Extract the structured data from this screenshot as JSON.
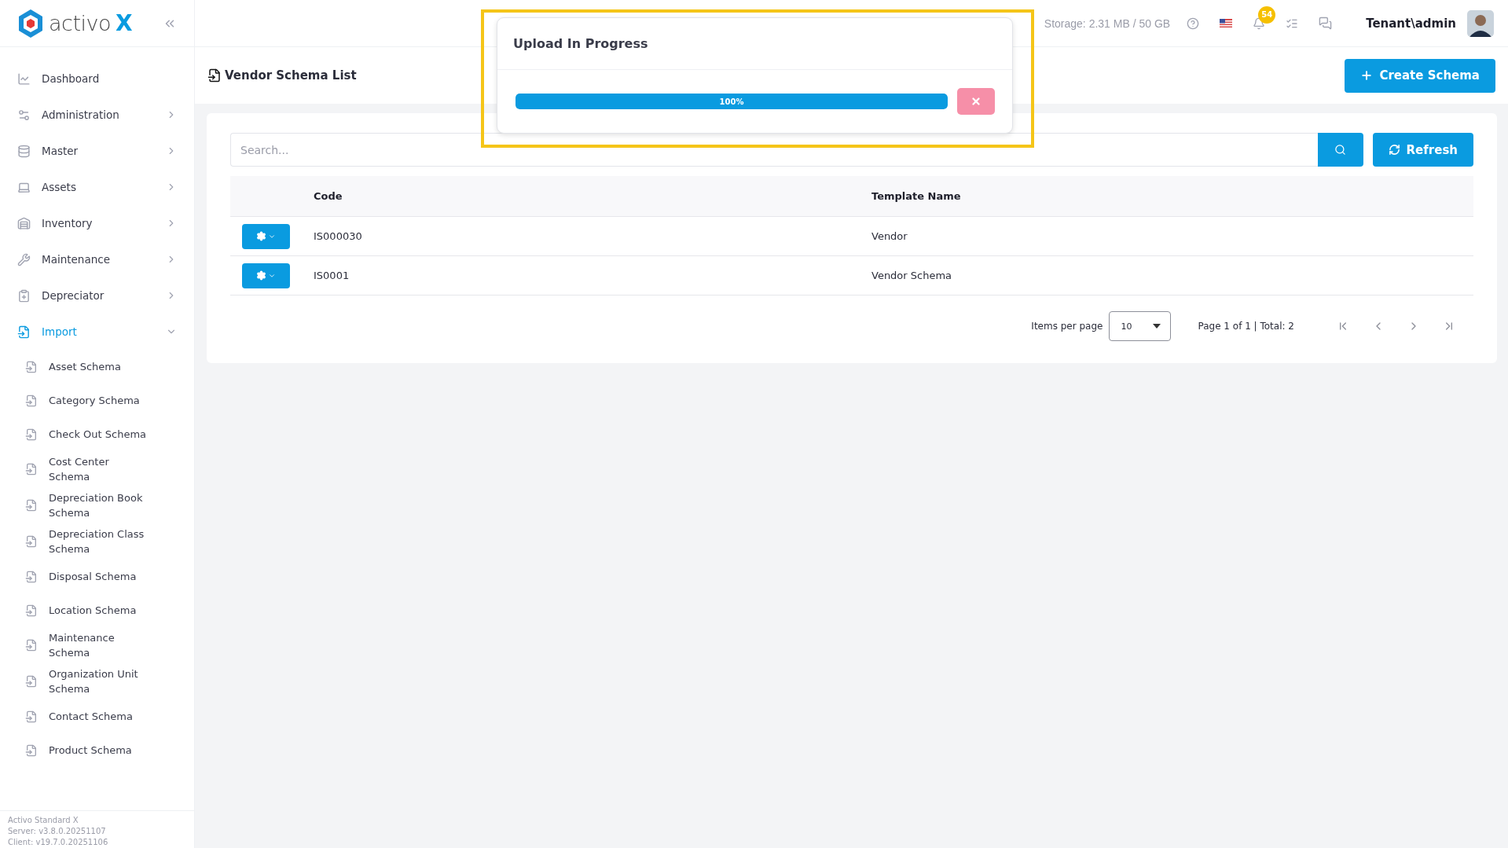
{
  "brand": {
    "name": "activo",
    "mark": "X"
  },
  "sidebar": {
    "items": [
      {
        "label": "Dashboard",
        "kind": "link",
        "selected": false
      },
      {
        "label": "Administration",
        "kind": "group",
        "selected": false,
        "expanded": false
      },
      {
        "label": "Master",
        "kind": "group",
        "selected": false,
        "expanded": false
      },
      {
        "label": "Assets",
        "kind": "group",
        "selected": false,
        "expanded": false
      },
      {
        "label": "Inventory",
        "kind": "group",
        "selected": false,
        "expanded": false
      },
      {
        "label": "Maintenance",
        "kind": "group",
        "selected": false,
        "expanded": false
      },
      {
        "label": "Depreciator",
        "kind": "group",
        "selected": false,
        "expanded": false
      },
      {
        "label": "Import",
        "kind": "group",
        "selected": true,
        "expanded": true,
        "children": [
          {
            "label": "Asset Schema",
            "selected": false
          },
          {
            "label": "Category Schema",
            "selected": false
          },
          {
            "label": "Check Out Schema",
            "selected": false
          },
          {
            "label": "Cost Center Schema",
            "selected": false
          },
          {
            "label": "Depreciation Book Schema",
            "selected": false
          },
          {
            "label": "Depreciation Class Schema",
            "selected": false
          },
          {
            "label": "Disposal Schema",
            "selected": false
          },
          {
            "label": "Location Schema",
            "selected": false
          },
          {
            "label": "Maintenance Schema",
            "selected": false
          },
          {
            "label": "Organization Unit Schema",
            "selected": false
          },
          {
            "label": "Contact Schema",
            "selected": false
          },
          {
            "label": "Product Schema",
            "selected": false
          }
        ]
      }
    ],
    "footer": [
      "Activo Standard X",
      "Server: v3.8.0.20251107",
      "Client: v19.7.0.20251106"
    ]
  },
  "header": {
    "storage": "Storage: 2.31 MB / 50 GB",
    "notification_count": "54",
    "user": "Tenant\\admin"
  },
  "page": {
    "title": "Vendor Schema List",
    "create_button": "Create Schema"
  },
  "search": {
    "placeholder": "Search...",
    "refresh_button": "Refresh"
  },
  "table": {
    "columns": [
      "Code",
      "Template Name"
    ],
    "rows": [
      {
        "code": "IS000030",
        "template_name": "Vendor"
      },
      {
        "code": "IS0001",
        "template_name": "Vendor Schema"
      }
    ]
  },
  "pagination": {
    "items_per_page_label": "Items per page",
    "items_per_page": "10",
    "page_info": "Page 1 of 1 | Total: 2"
  },
  "upload": {
    "title": "Upload In Progress",
    "level": 1,
    "reading": "100%"
  }
}
